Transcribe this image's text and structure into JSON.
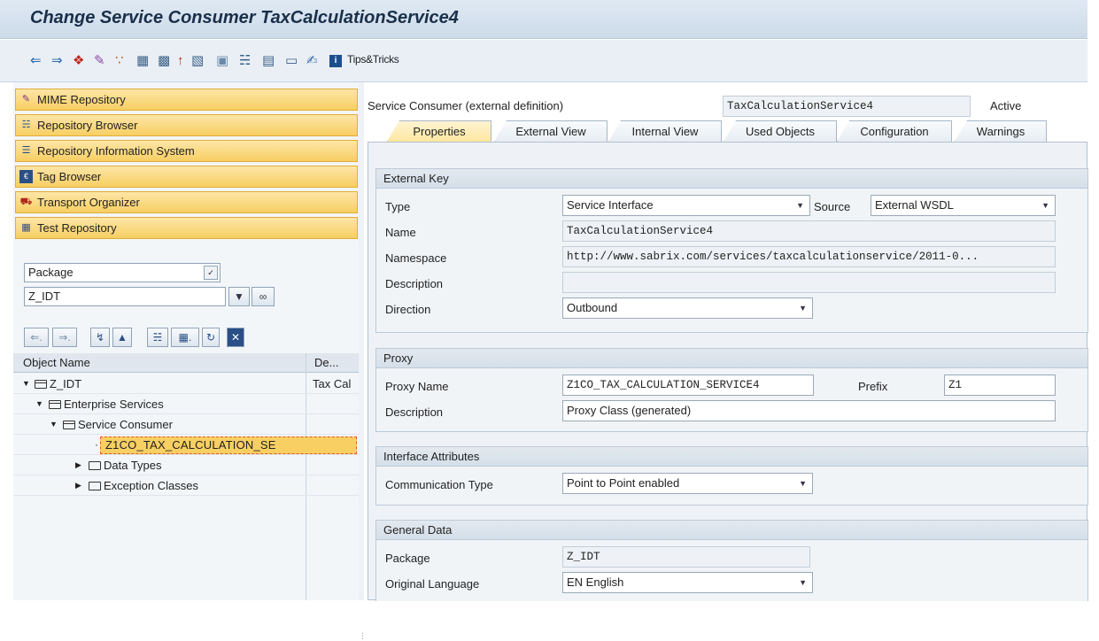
{
  "window": {
    "title": "Change Service Consumer TaxCalculationService4"
  },
  "toolbar": {
    "tips_label": "Tips&Tricks",
    "icons": [
      "back-icon",
      "forward-icon",
      "other-object-icon",
      "display-change-icon",
      "check-icon",
      "activate-icon",
      "where-used-icon",
      "info-icon",
      "object-list-icon",
      "navigation-window-icon",
      "hierarchy-icon",
      "display-object-list-icon",
      "fullscreen-icon",
      "edit-icon",
      "tips-tricks-icon"
    ]
  },
  "nav": {
    "items": [
      {
        "label": "MIME Repository",
        "icon": "mime-icon"
      },
      {
        "label": "Repository Browser",
        "icon": "repository-browser-icon"
      },
      {
        "label": "Repository Information System",
        "icon": "repository-info-icon"
      },
      {
        "label": "Tag Browser",
        "icon": "tag-browser-icon"
      },
      {
        "label": "Transport Organizer",
        "icon": "transport-icon"
      },
      {
        "label": "Test Repository",
        "icon": "test-repository-icon"
      }
    ]
  },
  "browser": {
    "object_type": "Package",
    "object_name": "Z_IDT"
  },
  "tree": {
    "columns": [
      "Object Name",
      "De..."
    ],
    "rows": [
      {
        "label": "Z_IDT",
        "desc": "Tax Cal",
        "level": 0,
        "twisty": "▼",
        "icon": "folder-open"
      },
      {
        "label": "Enterprise Services",
        "desc": "",
        "level": 1,
        "twisty": "▼",
        "icon": "folder-open"
      },
      {
        "label": "Service Consumer",
        "desc": "",
        "level": 2,
        "twisty": "▼",
        "icon": "folder-open"
      },
      {
        "label": "Z1CO_TAX_CALCULATION_SE",
        "desc": "",
        "level": 3,
        "twisty": "·",
        "icon": "",
        "selected": true
      },
      {
        "label": "Data Types",
        "desc": "",
        "level": 1,
        "twisty": "▶",
        "icon": "folder"
      },
      {
        "label": "Exception Classes",
        "desc": "",
        "level": 1,
        "twisty": "▶",
        "icon": "folder"
      }
    ]
  },
  "header": {
    "object_kind": "Service Consumer (external definition)",
    "object_name": "TaxCalculationService4",
    "status": "Active"
  },
  "tabs": [
    "Properties",
    "External View",
    "Internal View",
    "Used Objects",
    "Configuration",
    "Warnings"
  ],
  "external_key": {
    "title": "External Key",
    "type_label": "Type",
    "type_value": "Service Interface",
    "source_label": "Source",
    "source_value": "External WSDL",
    "name_label": "Name",
    "name_value": "TaxCalculationService4",
    "namespace_label": "Namespace",
    "namespace_value": "http://www.sabrix.com/services/taxcalculationservice/2011-0...",
    "description_label": "Description",
    "description_value": "",
    "direction_label": "Direction",
    "direction_value": "Outbound"
  },
  "proxy": {
    "title": "Proxy",
    "proxy_name_label": "Proxy Name",
    "proxy_name_value": "Z1CO_TAX_CALCULATION_SERVICE4",
    "prefix_label": "Prefix",
    "prefix_value": "Z1",
    "description_label": "Description",
    "description_value": "Proxy Class (generated)"
  },
  "interface_attributes": {
    "title": "Interface Attributes",
    "comm_type_label": "Communication Type",
    "comm_type_value": "Point to Point enabled"
  },
  "general_data": {
    "title": "General Data",
    "package_label": "Package",
    "package_value": "Z_IDT",
    "language_label": "Original Language",
    "language_value": "EN English"
  },
  "colors": {
    "accent_yellow": "#f7cf63",
    "selection_border": "#e05a2a",
    "title_text": "#1a2f4a"
  }
}
